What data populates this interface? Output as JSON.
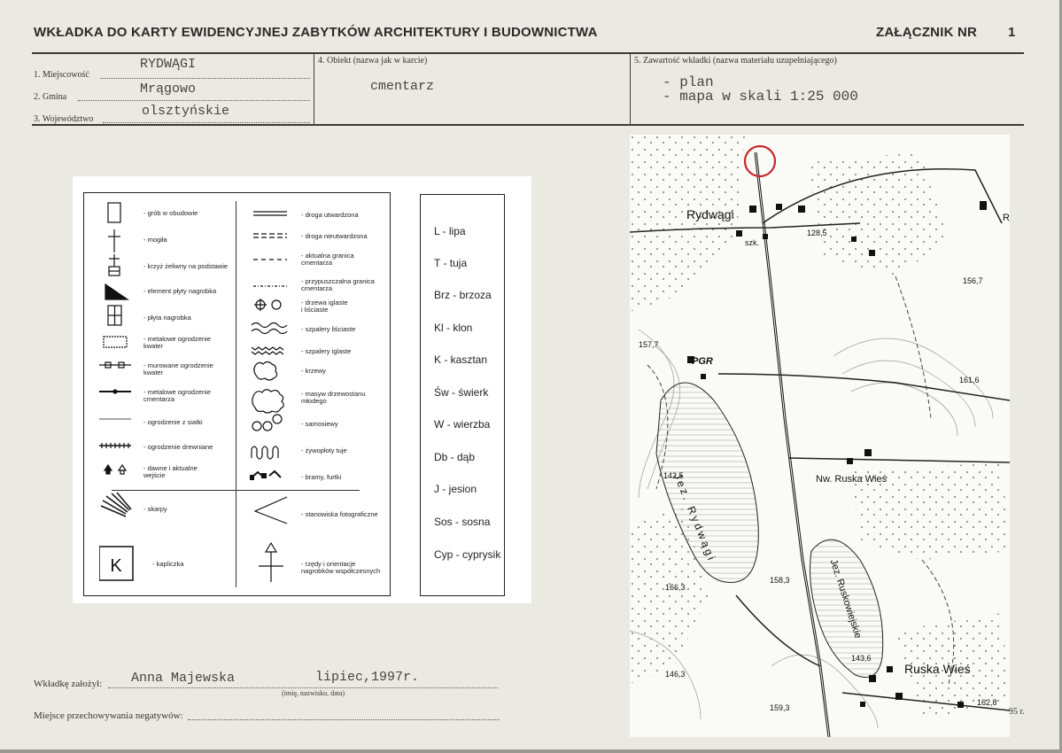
{
  "header": {
    "title": "WKŁADKA DO KARTY EWIDENCYJNEJ ZABYTKÓW ARCHITEKTURY I BUDOWNICTWA",
    "annex_label": "ZAŁĄCZNIK NR",
    "annex_number": "1"
  },
  "form": {
    "miejscowosc": {
      "label": "1. Miejscowość",
      "value": "RYDWĄGI"
    },
    "gmina": {
      "label": "2. Gmina",
      "value": "Mrągowo"
    },
    "wojewodztwo": {
      "label": "3. Województwo",
      "value": "olsztyńskie"
    },
    "obiekt": {
      "label": "4. Obiekt  (nazwa jak w karcie)",
      "value": "cmentarz"
    },
    "zawartosc": {
      "label": "5. Zawartość wkładki  (nazwa materiału uzupełniającego)",
      "items": [
        "- plan",
        "- mapa w skali 1:25 000"
      ]
    }
  },
  "legend": {
    "left_col": [
      {
        "icon": "grave-icon",
        "text": "- grób w obudowie"
      },
      {
        "icon": "cross-icon",
        "text": "- mogiła"
      },
      {
        "icon": "iron-cross-icon",
        "text": "- krzyż żeliwny na podstawie"
      },
      {
        "icon": "slab-element-icon",
        "text": "- element płyty nagrobka"
      },
      {
        "icon": "slab-icon",
        "text": "- płyta nagrobka"
      },
      {
        "icon": "metal-fence-quarter-icon",
        "text": "- metalowe ogrodzenie\nkwater"
      },
      {
        "icon": "brick-fence-icon",
        "text": "- murowane ogrodzenie\nkwater"
      },
      {
        "icon": "metal-fence-cemetery-icon",
        "text": "- metalowe ogrodzenie\ncmentarza"
      },
      {
        "icon": "wire-fence-icon",
        "text": "- ogrodzenie z siatki"
      },
      {
        "icon": "wood-fence-icon",
        "text": "- ogrodzenie drewniane"
      },
      {
        "icon": "entrance-icon",
        "text": "- dawne i aktualne\nwejście"
      },
      {
        "icon": "slope-icon",
        "text": "- skarpy"
      },
      {
        "icon": "chapel-icon",
        "text": "- kapliczka",
        "letter": "K"
      }
    ],
    "right_col": [
      {
        "icon": "paved-road-icon",
        "text": "- droga utwardzona"
      },
      {
        "icon": "unpaved-road-icon",
        "text": "- droga nieutwardzona"
      },
      {
        "icon": "current-border-icon",
        "text": "- aktualna granica\ncmentarza"
      },
      {
        "icon": "presumed-border-icon",
        "text": "- przypuszczalna granica\ncmentarza"
      },
      {
        "icon": "trees-icon",
        "text": "- drzewa iglaste\ni liściaste"
      },
      {
        "icon": "deciduous-row-icon",
        "text": "- szpalery liściaste"
      },
      {
        "icon": "conifer-row-icon",
        "text": "- szpalery iglaste"
      },
      {
        "icon": "shrubs-icon",
        "text": "- krzewy"
      },
      {
        "icon": "young-stand-icon",
        "text": "- masyw drzewostanu\nmłodego"
      },
      {
        "icon": "self-seeded-icon",
        "text": "- samosiewy"
      },
      {
        "icon": "thuja-hedge-icon",
        "text": "- żywopłoty tuje"
      },
      {
        "icon": "gates-icon",
        "text": "- bramy, furtki"
      },
      {
        "icon": "photo-position-icon",
        "text": "- stanowiska fotograficzne"
      },
      {
        "icon": "grave-orientation-icon",
        "text": "- rzędy i orientacje\nnagrobków współczesnych"
      }
    ],
    "abbreviations": [
      "L  - lipa",
      "T  - tuja",
      "Brz - brzoza",
      "Kl  - klon",
      "K  - kasztan",
      "Św  - świerk",
      "W  - wierzba",
      "Db  - dąb",
      "J  - jesion",
      "Sos - sosna",
      "Cyp - cyprysik"
    ]
  },
  "map": {
    "labels": {
      "rydwagi": "Rydwągi",
      "szk": "szk.",
      "h128": "128,5",
      "h156": "156,7",
      "h157": "157,7",
      "pgr": "PGR",
      "h161": "161,6",
      "lake1": "Jez. Rydwągi",
      "h142": "142,5",
      "nw_ruska": "Nw. Ruska Wieś",
      "lake2": "Jez. Ruskowiejskie",
      "h158": "158,3",
      "h166": "166,3",
      "h143": "143,6",
      "h146": "146,3",
      "ruska": "Ruska Wieś",
      "h159": "159,3",
      "h162": "162,8",
      "r": "R"
    }
  },
  "footer": {
    "zalozyl_label": "Wkładkę założył:",
    "zalozyl_name": "Anna Majewska",
    "zalozyl_date": "lipiec,1997r.",
    "zalozyl_hint": "(imię, nazwisko, data)",
    "miejsce_label": "Miejsce przechowywania negatywów:",
    "stamp": "95 r."
  }
}
